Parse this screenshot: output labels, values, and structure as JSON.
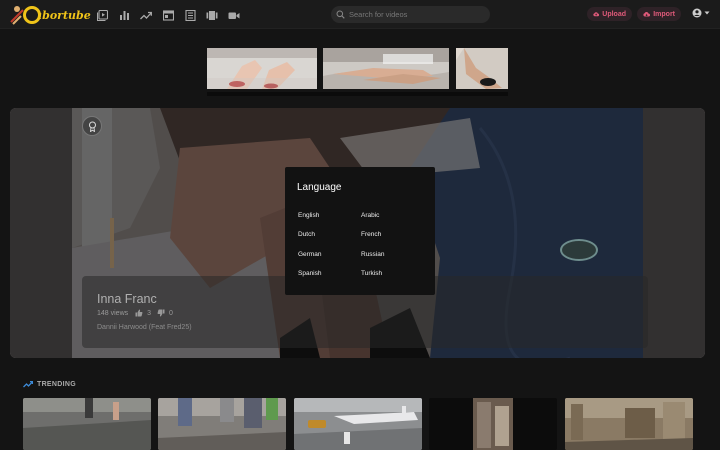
{
  "app": {
    "logo_text": "abortube",
    "brand_color": "#f0c419",
    "accent_color": "#e05a7a"
  },
  "nav_icons": [
    "video-library-icon",
    "bar-chart-icon",
    "trending-icon",
    "channel-icon",
    "playlist-icon",
    "albums-icon",
    "camera-icon"
  ],
  "search": {
    "placeholder": "Search for videos"
  },
  "header_actions": {
    "upload_label": "Upload",
    "import_label": "Import"
  },
  "hero": {
    "title": "Inna Franc",
    "views": "148 views",
    "likes": "3",
    "dislikes": "0",
    "artist": "Dannii Harwood (Feat Fred25)"
  },
  "language_modal": {
    "title": "Language",
    "languages": [
      "English",
      "Arabic",
      "Dutch",
      "French",
      "German",
      "Russian",
      "Spanish",
      "Turkish"
    ]
  },
  "trending": {
    "label": "TRENDING"
  }
}
